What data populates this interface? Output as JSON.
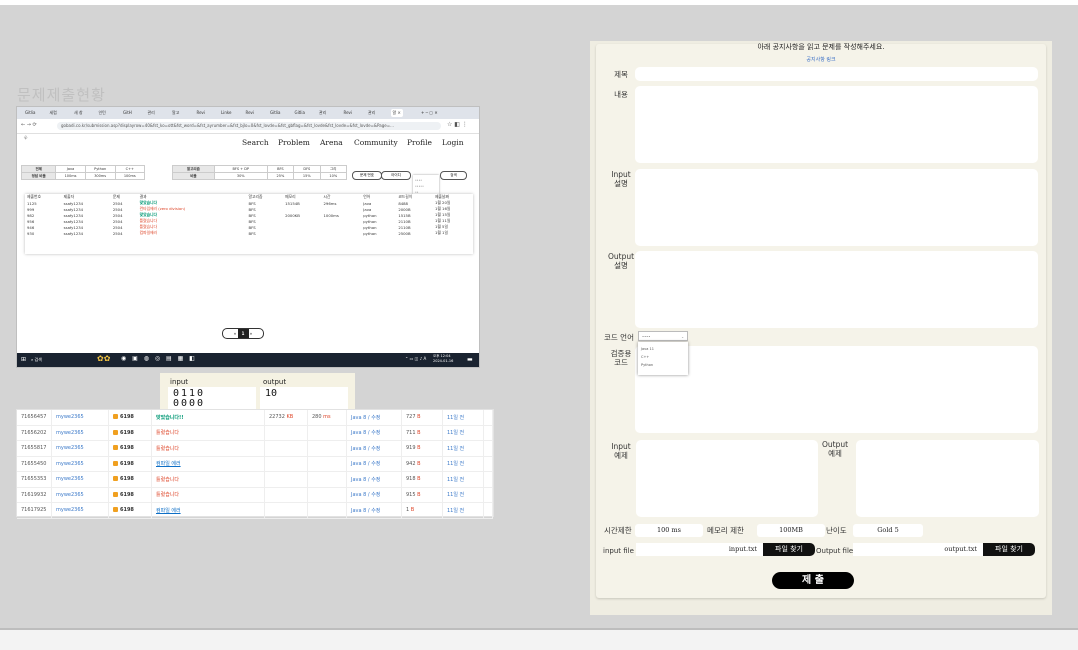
{
  "left_title": "문제제출현황",
  "browser": {
    "tabs": [
      "Gitlia",
      "세렵",
      "새 창",
      "인턴",
      "GitH",
      "관리",
      "알고",
      "Revi",
      "Linke",
      "Revi",
      "Gitlia",
      "Gitlia",
      "관리",
      "Revi",
      "관리",
      "알 ×"
    ],
    "url": "gobadi.co.kr/submission.asp?displayrow=40&fst_ko=ott&fst_word=&fst_ayrumber=&fst_bjlo=0&fst_lovde=&fst_gbflag=&fst_lovde&fst_lovde=&fst_lovde=&Page=...",
    "nav": [
      "Search",
      "Problem",
      "Arena",
      "Community",
      "Profile",
      "Login"
    ],
    "lang_filter": {
      "row1": [
        "전체",
        "Java",
        "Python",
        "C++"
      ],
      "row2": [
        "정답 비율",
        "100ms",
        "300ms",
        "100ms"
      ]
    },
    "algo_filter": {
      "row1": [
        "알고리즘",
        "BFS + DP",
        "BFS",
        "DFS",
        "그리"
      ],
      "row2": [
        "비율",
        "30%",
        "25%",
        "15%",
        "10%"
      ]
    },
    "search": {
      "select": "문제 번호",
      "input": "아이디",
      "button": "검색"
    },
    "dropdown": [
      "••••",
      "•••••",
      "••"
    ],
    "result_headers": [
      "제출번호",
      "제출자",
      "문제",
      "결과",
      "알고리즘",
      "메모리",
      "시간",
      "언어",
      "코드길이",
      "제출날짜"
    ],
    "results": [
      [
        "1125",
        "ssafy1234",
        "2504",
        "맞았습니다",
        "BFS",
        "15154B",
        "296ms",
        "Java",
        "8488",
        "1월 20일"
      ],
      [
        "999",
        "ssafy1234",
        "2504",
        "런타임에러 (zero division)",
        "BFS",
        "",
        "",
        "Java",
        "2000B",
        "1월 16일"
      ],
      [
        "982",
        "ssafy1234",
        "2504",
        "맞았습니다",
        "BFS",
        "2000KB",
        "1000ms",
        "python",
        "1515B",
        "1월 15일"
      ],
      [
        "956",
        "ssafy1234",
        "2504",
        "틀렸습니다",
        "BFS",
        "",
        "",
        "python",
        "2110B",
        "1월 11일"
      ],
      [
        "946",
        "ssafy1234",
        "2504",
        "틀렸습니다",
        "BFS",
        "",
        "",
        "python",
        "2110B",
        "1월 5일"
      ],
      [
        "930",
        "ssafy1234",
        "2504",
        "컴파일에러",
        "BFS",
        "",
        "",
        "python",
        "2500B",
        "1월 1일"
      ]
    ],
    "pagination": {
      "prev": "«",
      "current": "1",
      "next": "»"
    },
    "taskbar": {
      "search": "검색",
      "clock": "오후 12:04\n2024-01-16"
    }
  },
  "io": {
    "input_label": "input",
    "output_label": "output",
    "input_value": "0110\n0000",
    "output_value": "10"
  },
  "submissions": [
    {
      "id": "71656457",
      "user": "mywe2365",
      "problem": "6198",
      "result": "맞았습니다!!",
      "result_type": "ok",
      "memory": "22732",
      "memory_unit": "KB",
      "time": "280",
      "time_unit": "ms",
      "lang": "Java 8 / 수정",
      "length": "727",
      "length_unit": "B",
      "when": "11일 전"
    },
    {
      "id": "71656202",
      "user": "mywe2365",
      "problem": "6198",
      "result": "틀렸습니다",
      "result_type": "wa",
      "memory": "",
      "memory_unit": "",
      "time": "",
      "time_unit": "",
      "lang": "Java 8 / 수정",
      "length": "711",
      "length_unit": "B",
      "when": "11일 전"
    },
    {
      "id": "71655817",
      "user": "mywe2365",
      "problem": "6198",
      "result": "틀렸습니다",
      "result_type": "wa",
      "memory": "",
      "memory_unit": "",
      "time": "",
      "time_unit": "",
      "lang": "Java 8 / 수정",
      "length": "919",
      "length_unit": "B",
      "when": "11일 전"
    },
    {
      "id": "71655450",
      "user": "mywe2365",
      "problem": "6198",
      "result": "컴파일 에러",
      "result_type": "ce",
      "memory": "",
      "memory_unit": "",
      "time": "",
      "time_unit": "",
      "lang": "Java 8 / 수정",
      "length": "942",
      "length_unit": "B",
      "when": "11일 전"
    },
    {
      "id": "71655353",
      "user": "mywe2365",
      "problem": "6198",
      "result": "틀렸습니다",
      "result_type": "wa",
      "memory": "",
      "memory_unit": "",
      "time": "",
      "time_unit": "",
      "lang": "Java 8 / 수정",
      "length": "918",
      "length_unit": "B",
      "when": "11일 전"
    },
    {
      "id": "71619932",
      "user": "mywe2365",
      "problem": "6198",
      "result": "틀렸습니다",
      "result_type": "wa",
      "memory": "",
      "memory_unit": "",
      "time": "",
      "time_unit": "",
      "lang": "Java 8 / 수정",
      "length": "915",
      "length_unit": "B",
      "when": "11일 전"
    },
    {
      "id": "71617925",
      "user": "mywe2365",
      "problem": "6198",
      "result": "컴파일 에러",
      "result_type": "ce",
      "memory": "",
      "memory_unit": "",
      "time": "",
      "time_unit": "",
      "lang": "Java 8 / 수정",
      "length": "1",
      "length_unit": "B",
      "when": "11일 전"
    }
  ],
  "form": {
    "guide": "아래 공지사항을 읽고 문제를 작성해주세요.",
    "guide_link": "공지사항 링크",
    "title_label": "제목",
    "content_label": "내용",
    "input_desc_label": "Input\n설명",
    "output_desc_label": "Output\n설명",
    "code_lang_label": "코드 언어",
    "code_lang_value": "••••",
    "code_lang_options": [
      "Java 11",
      "C++",
      "Python"
    ],
    "verify_code_label": "검증용\n코드",
    "input_example_label": "Input\n예제",
    "output_example_label": "Output\n예제",
    "time_limit_label": "시간제한",
    "time_limit_value": "100 ms",
    "memory_limit_label": "메모리 제한",
    "memory_limit_value": "100MB",
    "difficulty_label": "난이도",
    "difficulty_value": "Gold 5",
    "input_file_label": "input file",
    "input_file_name": "input.txt",
    "output_file_label": "Output file",
    "output_file_name": "output.txt",
    "file_button": "파일 찾기",
    "submit": "제 출"
  },
  "colors": {
    "accepted": "#009874",
    "wrong": "#dd4124",
    "compile_error": "#0e6fc6",
    "form_bg": "#f5f3e9",
    "button": "#000000"
  }
}
